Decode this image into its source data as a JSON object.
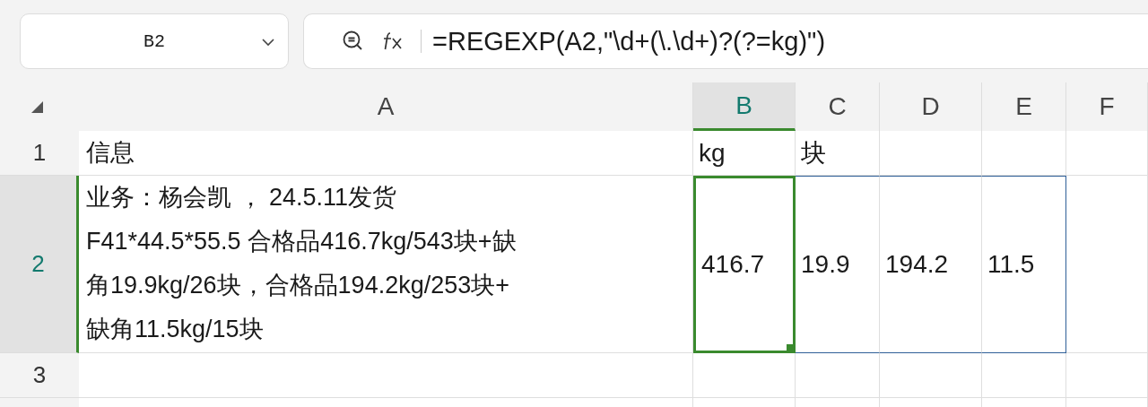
{
  "name_box": {
    "value": "B2"
  },
  "formula_bar": {
    "value": "=REGEXP(A2,\"\\d+(\\.\\d+)?(?=kg)\")"
  },
  "columns": [
    {
      "label": "A",
      "selected": false
    },
    {
      "label": "B",
      "selected": true
    },
    {
      "label": "C",
      "selected": false
    },
    {
      "label": "D",
      "selected": false
    },
    {
      "label": "E",
      "selected": false
    },
    {
      "label": "F",
      "selected": false
    }
  ],
  "rows": [
    {
      "number": "1",
      "selected": false,
      "cells": [
        {
          "lines": [
            "信息"
          ],
          "active": false,
          "in_range": false
        },
        {
          "lines": [
            "kg"
          ],
          "active": false,
          "in_range": false
        },
        {
          "lines": [
            "块"
          ],
          "active": false,
          "in_range": false
        },
        {
          "active": false,
          "in_range": false
        },
        {
          "active": false,
          "in_range": false
        },
        {
          "active": false,
          "in_range": false
        }
      ]
    },
    {
      "number": "2",
      "selected": true,
      "cells": [
        {
          "lines": [
            "业务：杨会凯 ， 24.5.11发货",
            "F41*44.5*55.5 合格品416.7kg/543块+缺",
            "角19.9kg/26块，合格品194.2kg/253块+",
            "缺角11.5kg/15块"
          ],
          "active": false,
          "in_range": false
        },
        {
          "lines": [
            "416.7"
          ],
          "active": true,
          "in_range": true
        },
        {
          "lines": [
            "19.9"
          ],
          "active": false,
          "in_range": true
        },
        {
          "lines": [
            "194.2"
          ],
          "active": false,
          "in_range": true
        },
        {
          "lines": [
            "11.5"
          ],
          "active": false,
          "in_range": true
        },
        {
          "active": false,
          "in_range": false
        }
      ]
    },
    {
      "number": "3",
      "selected": false,
      "cells": [
        {
          "active": false,
          "in_range": false
        },
        {
          "active": false,
          "in_range": false
        },
        {
          "active": false,
          "in_range": false
        },
        {
          "active": false,
          "in_range": false
        },
        {
          "active": false,
          "in_range": false
        },
        {
          "active": false,
          "in_range": false
        }
      ]
    }
  ]
}
